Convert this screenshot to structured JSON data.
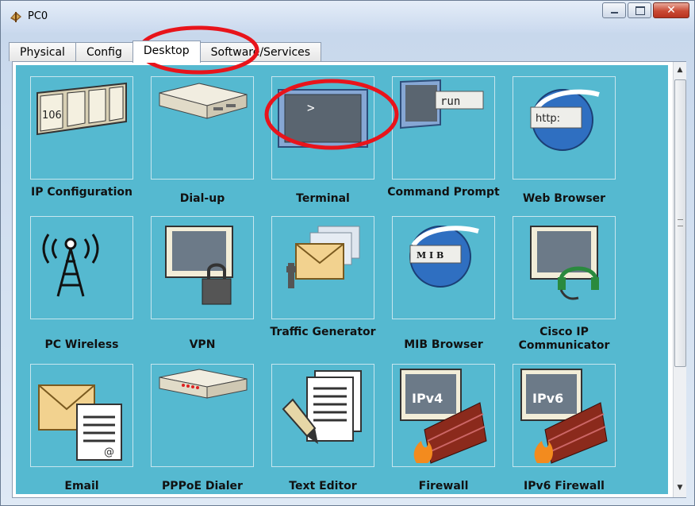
{
  "window": {
    "title": "PC0"
  },
  "tabs": [
    "Physical",
    "Config",
    "Desktop",
    "Software/Services"
  ],
  "active_tab": "Desktop",
  "apps": [
    {
      "label": "IP Configuration",
      "icon": "ip-configuration-icon"
    },
    {
      "label": "Dial-up",
      "icon": "modem-icon"
    },
    {
      "label": "Terminal",
      "icon": "terminal-icon"
    },
    {
      "label": "Command Prompt",
      "icon": "command-prompt-icon"
    },
    {
      "label": "Web Browser",
      "icon": "web-browser-icon"
    },
    {
      "label": "PC Wireless",
      "icon": "wireless-antenna-icon"
    },
    {
      "label": "VPN",
      "icon": "vpn-lock-icon"
    },
    {
      "label": "Traffic Generator",
      "icon": "traffic-generator-icon"
    },
    {
      "label": "MIB Browser",
      "icon": "mib-browser-icon"
    },
    {
      "label": "Cisco IP Communicator",
      "icon": "ip-communicator-headset-icon"
    },
    {
      "label": "Email",
      "icon": "email-icon"
    },
    {
      "label": "PPPoE Dialer",
      "icon": "pppoe-dialer-icon"
    },
    {
      "label": "Text Editor",
      "icon": "text-editor-icon"
    },
    {
      "label": "Firewall",
      "icon": "firewall-icon"
    },
    {
      "label": "IPv6 Firewall",
      "icon": "ipv6-firewall-icon"
    }
  ],
  "icon_text": {
    "ip_config": "106",
    "terminal": ">",
    "command_prompt": "run",
    "web_browser": "http:",
    "mib": "M I B",
    "ipv4": "IPv4",
    "ipv6": "IPv6"
  },
  "colors": {
    "panel_background": "#55b9d0",
    "annotation_red": "#e8141b"
  },
  "annotations": [
    "desktop-tab-highlight",
    "terminal-icon-highlight"
  ]
}
